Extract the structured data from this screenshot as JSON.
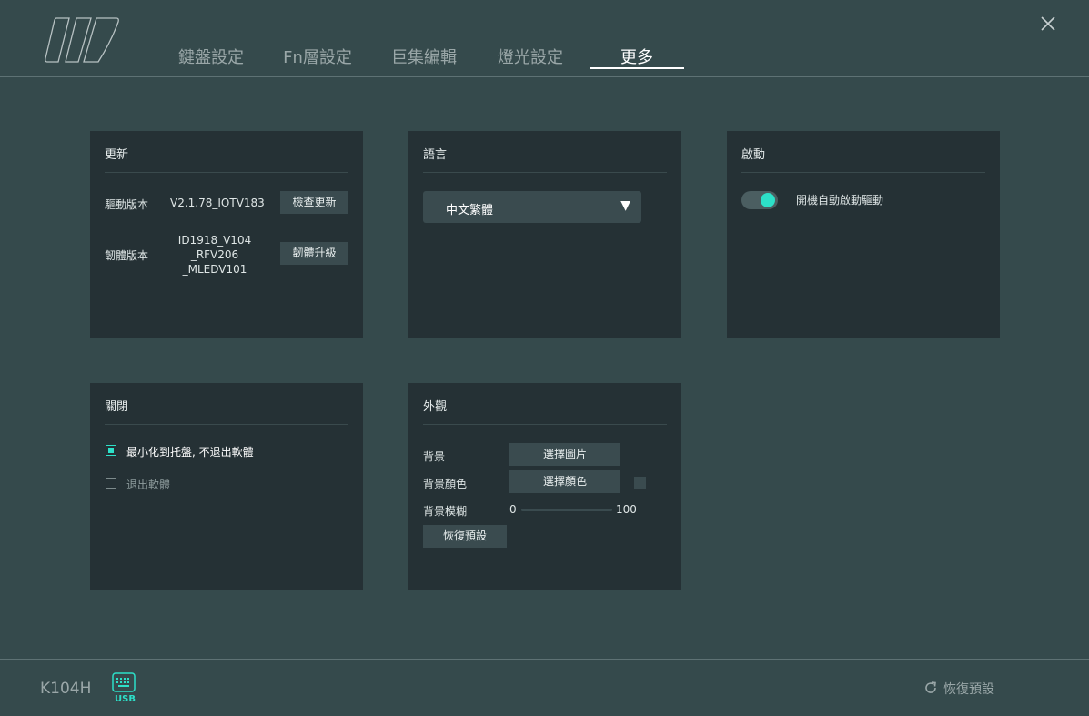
{
  "header": {
    "tabs": [
      {
        "label": "鍵盤設定"
      },
      {
        "label": "Fn層設定"
      },
      {
        "label": "巨集編輯"
      },
      {
        "label": "燈光設定"
      },
      {
        "label": "更多",
        "active": true
      }
    ],
    "close_icon": "close-icon"
  },
  "update_panel": {
    "title": "更新",
    "driver_label": "驅動版本",
    "driver_value": "V2.1.78_IOTV183",
    "check_button": "檢查更新",
    "firmware_label": "韌體版本",
    "firmware_value_lines": [
      "ID1918_V104",
      "_RFV206",
      "_MLEDV101"
    ],
    "upgrade_button": "韌體升級"
  },
  "language_panel": {
    "title": "語言",
    "selected": "中文繁體"
  },
  "startup_panel": {
    "title": "啟動",
    "toggle_label": "開機自動啟動驅動",
    "toggle_on": true
  },
  "close_panel": {
    "title": "關閉",
    "option_minimize": "最小化到托盤, 不退出軟體",
    "option_minimize_checked": true,
    "option_exit": "退出軟體",
    "option_exit_checked": false
  },
  "appearance_panel": {
    "title": "外觀",
    "bg_label": "背景",
    "bg_button": "選擇圖片",
    "bg_color_label": "背景顏色",
    "bg_color_button": "選擇顏色",
    "bg_blur_label": "背景模糊",
    "blur_min": "0",
    "blur_max": "100",
    "blur_value": 0,
    "reset_button": "恢復預設"
  },
  "footer": {
    "model": "K104H",
    "connection": "USB",
    "restore_label": "恢復預設"
  },
  "colors": {
    "background": "#354a4c",
    "panel": "#253135",
    "accent": "#2de0c8"
  }
}
